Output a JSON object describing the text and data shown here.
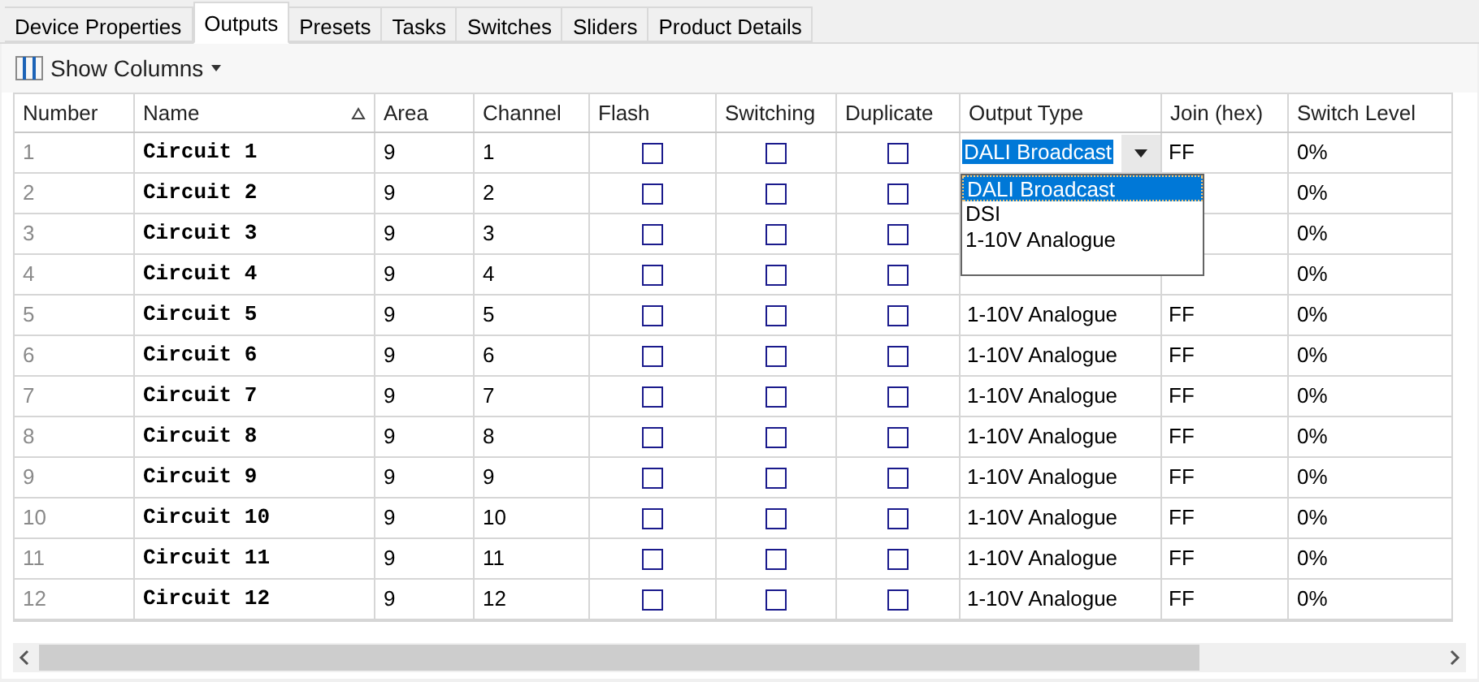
{
  "tabs": [
    {
      "label": "Device Properties",
      "selected": false
    },
    {
      "label": "Outputs",
      "selected": true
    },
    {
      "label": "Presets",
      "selected": false
    },
    {
      "label": "Tasks",
      "selected": false
    },
    {
      "label": "Switches",
      "selected": false
    },
    {
      "label": "Sliders",
      "selected": false
    },
    {
      "label": "Product Details",
      "selected": false
    }
  ],
  "toolbar": {
    "show_columns": "Show Columns"
  },
  "table": {
    "columns": [
      {
        "label": "Number",
        "sorted": false
      },
      {
        "label": "Name",
        "sorted": true
      },
      {
        "label": "Area",
        "sorted": false
      },
      {
        "label": "Channel",
        "sorted": false
      },
      {
        "label": "Flash",
        "sorted": false
      },
      {
        "label": "Switching",
        "sorted": false
      },
      {
        "label": "Duplicate",
        "sorted": false
      },
      {
        "label": "Output Type",
        "sorted": false
      },
      {
        "label": "Join (hex)",
        "sorted": false
      },
      {
        "label": "Switch Level",
        "sorted": false
      }
    ],
    "rows": [
      {
        "number": "1",
        "name": "Circuit 1",
        "area": "9",
        "channel": "1",
        "flash": false,
        "switching": false,
        "duplicate": false,
        "output_type": "DALI Broadcast",
        "join": "FF",
        "switch_level": "0%",
        "editing": true
      },
      {
        "number": "2",
        "name": "Circuit 2",
        "area": "9",
        "channel": "2",
        "flash": false,
        "switching": false,
        "duplicate": false,
        "switch_level": "0%",
        "editing": false
      },
      {
        "number": "3",
        "name": "Circuit 3",
        "area": "9",
        "channel": "3",
        "flash": false,
        "switching": false,
        "duplicate": false,
        "switch_level": "0%",
        "editing": false
      },
      {
        "number": "4",
        "name": "Circuit 4",
        "area": "9",
        "channel": "4",
        "flash": false,
        "switching": false,
        "duplicate": false,
        "switch_level": "0%",
        "editing": false
      },
      {
        "number": "5",
        "name": "Circuit 5",
        "area": "9",
        "channel": "5",
        "flash": false,
        "switching": false,
        "duplicate": false,
        "output_type": "1-10V Analogue",
        "join": "FF",
        "switch_level": "0%",
        "editing": false
      },
      {
        "number": "6",
        "name": "Circuit 6",
        "area": "9",
        "channel": "6",
        "flash": false,
        "switching": false,
        "duplicate": false,
        "output_type": "1-10V Analogue",
        "join": "FF",
        "switch_level": "0%",
        "editing": false
      },
      {
        "number": "7",
        "name": "Circuit 7",
        "area": "9",
        "channel": "7",
        "flash": false,
        "switching": false,
        "duplicate": false,
        "output_type": "1-10V Analogue",
        "join": "FF",
        "switch_level": "0%",
        "editing": false
      },
      {
        "number": "8",
        "name": "Circuit 8",
        "area": "9",
        "channel": "8",
        "flash": false,
        "switching": false,
        "duplicate": false,
        "output_type": "1-10V Analogue",
        "join": "FF",
        "switch_level": "0%",
        "editing": false
      },
      {
        "number": "9",
        "name": "Circuit 9",
        "area": "9",
        "channel": "9",
        "flash": false,
        "switching": false,
        "duplicate": false,
        "output_type": "1-10V Analogue",
        "join": "FF",
        "switch_level": "0%",
        "editing": false
      },
      {
        "number": "10",
        "name": "Circuit 10",
        "area": "9",
        "channel": "10",
        "flash": false,
        "switching": false,
        "duplicate": false,
        "output_type": "1-10V Analogue",
        "join": "FF",
        "switch_level": "0%",
        "editing": false
      },
      {
        "number": "11",
        "name": "Circuit 11",
        "area": "9",
        "channel": "11",
        "flash": false,
        "switching": false,
        "duplicate": false,
        "output_type": "1-10V Analogue",
        "join": "FF",
        "switch_level": "0%",
        "editing": false
      },
      {
        "number": "12",
        "name": "Circuit 12",
        "area": "9",
        "channel": "12",
        "flash": false,
        "switching": false,
        "duplicate": false,
        "output_type": "1-10V Analogue",
        "join": "FF",
        "switch_level": "0%",
        "editing": false
      }
    ]
  },
  "dropdown": {
    "options": [
      {
        "label": "DALI Broadcast",
        "selected": true
      },
      {
        "label": "DSI",
        "selected": false
      },
      {
        "label": "1-10V Analogue",
        "selected": false
      }
    ]
  }
}
